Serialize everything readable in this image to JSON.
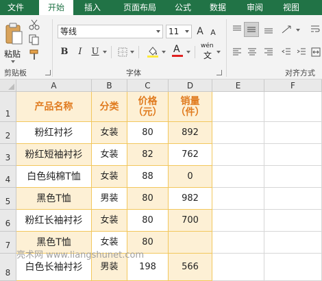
{
  "tabs": [
    "文件",
    "开始",
    "插入",
    "页面布局",
    "公式",
    "数据",
    "审阅",
    "视图"
  ],
  "ribbon": {
    "clipboard": {
      "paste_label": "粘贴",
      "group_label": "剪贴板"
    },
    "font": {
      "family": "等线",
      "size": "11",
      "grow": "A",
      "shrink": "A",
      "bold": "B",
      "italic": "I",
      "underline": "U",
      "font_color_glyph": "A",
      "phonetic_top": "wén",
      "phonetic_bottom": "文",
      "group_label": "字体"
    },
    "alignment": {
      "group_label": "对齐方式"
    }
  },
  "columns": [
    "A",
    "B",
    "C",
    "D",
    "E",
    "F"
  ],
  "rows": [
    "1",
    "2",
    "3",
    "4",
    "5",
    "6",
    "7",
    "8"
  ],
  "headers": {
    "name": "产品名称",
    "category": "分类",
    "price": "价格\n（元）",
    "sales": "销量\n（件）"
  },
  "table": [
    {
      "name": "粉红衬衫",
      "category": "女装",
      "price": "80",
      "sales": "892"
    },
    {
      "name": "粉红短袖衬衫",
      "category": "女装",
      "price": "82",
      "sales": "762"
    },
    {
      "name": "白色纯棉T恤",
      "category": "女装",
      "price": "88",
      "sales": "0"
    },
    {
      "name": "黑色T恤",
      "category": "男装",
      "price": "80",
      "sales": "982"
    },
    {
      "name": "粉红长袖衬衫",
      "category": "女装",
      "price": "80",
      "sales": "700"
    },
    {
      "name": "黑色T恤",
      "category": "女装",
      "price": "80",
      "sales": ""
    },
    {
      "name": "白色长袖衬衫",
      "category": "男装",
      "price": "198",
      "sales": "566"
    }
  ],
  "watermark": "亮术网 www.liangshunet.com",
  "colors": {
    "ribbon_green": "#217346",
    "header_text": "#e07b1f",
    "cell_shade": "#fdf0d5",
    "fill_yellow": "#ffeb3b",
    "font_red": "#e02020"
  }
}
